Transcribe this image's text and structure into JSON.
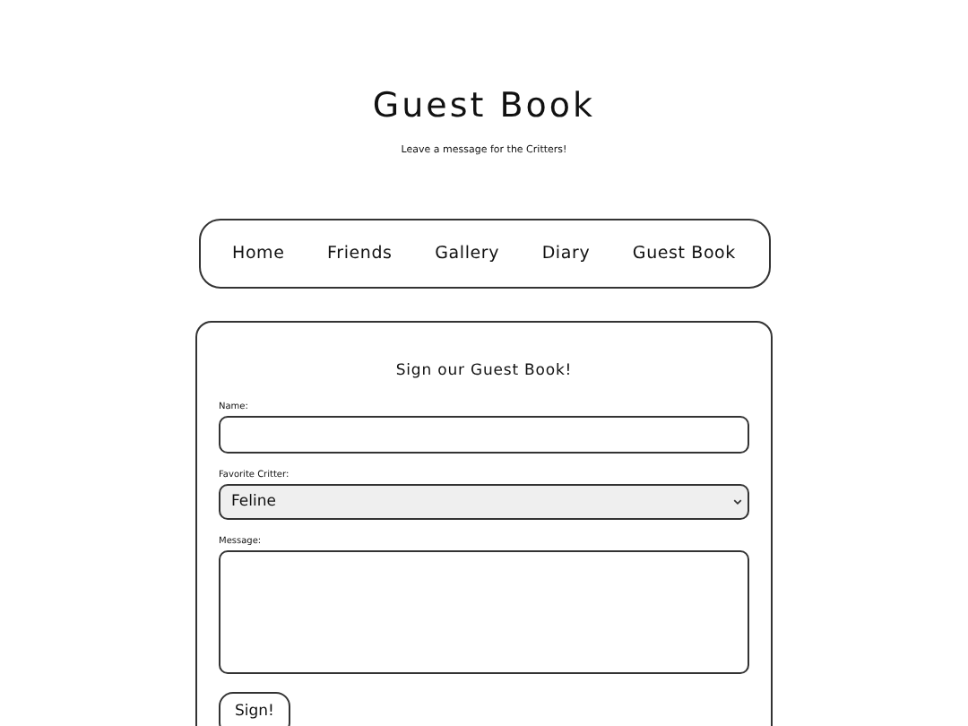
{
  "header": {
    "title": "Guest Book",
    "subtitle": "Leave a message for the Critters!"
  },
  "nav": [
    {
      "label": "Home"
    },
    {
      "label": "Friends"
    },
    {
      "label": "Gallery"
    },
    {
      "label": "Diary"
    },
    {
      "label": "Guest Book"
    }
  ],
  "form": {
    "heading": "Sign our Guest Book!",
    "fields": [
      {
        "kind": "text",
        "label": "Name:"
      },
      {
        "kind": "select",
        "label": "Favorite Critter:",
        "value": "Feline"
      },
      {
        "kind": "textarea",
        "label": "Message:"
      }
    ],
    "submit": "Sign!"
  }
}
